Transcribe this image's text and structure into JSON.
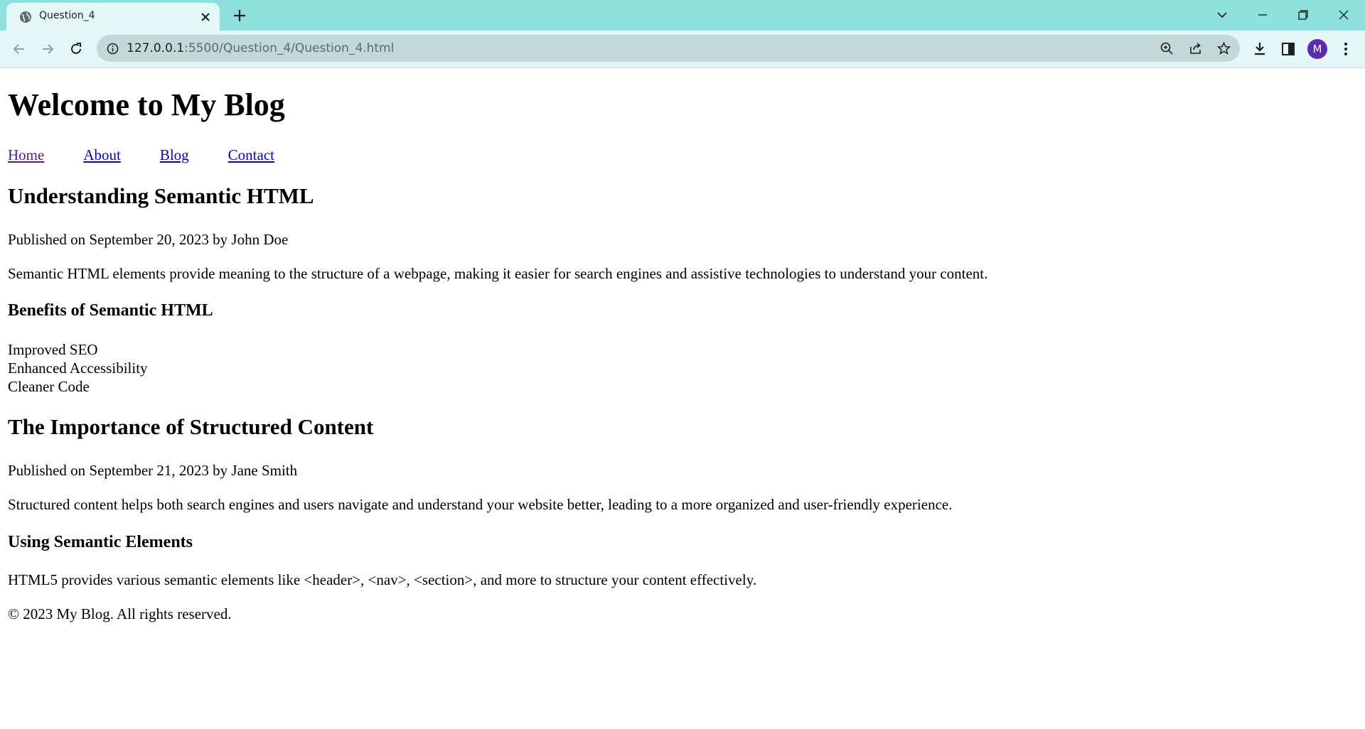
{
  "browser": {
    "tab_title": "Question_4",
    "url_host": "127.0.0.1",
    "url_rest": ":5500/Question_4/Question_4.html",
    "profile_initial": "M",
    "accent_color": "#8ee0dc",
    "avatar_color": "#5b2bb5"
  },
  "page": {
    "site_title": "Welcome to My Blog",
    "nav": [
      "Home",
      "About",
      "Blog",
      "Contact"
    ],
    "articles": [
      {
        "title": "Understanding Semantic HTML",
        "meta": "Published on September 20, 2023 by John Doe",
        "text": "Semantic HTML elements provide meaning to the structure of a webpage, making it easier for search engines and assistive technologies to understand your content.",
        "subheading": "Benefits of Semantic HTML",
        "list": [
          "Improved SEO",
          "Enhanced Accessibility",
          "Cleaner Code"
        ]
      },
      {
        "title": "The Importance of Structured Content",
        "meta": "Published on September 21, 2023 by Jane Smith",
        "text": "Structured content helps both search engines and users navigate and understand your website better, leading to a more organized and user-friendly experience.",
        "subheading": "Using Semantic Elements",
        "subtext": "HTML5 provides various semantic elements like <header>, <nav>, <section>, and more to structure your content effectively."
      }
    ],
    "footer": "© 2023 My Blog. All rights reserved."
  }
}
